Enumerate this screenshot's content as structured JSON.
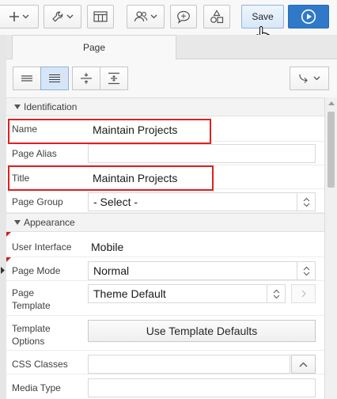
{
  "toolbar": {
    "items": [
      {
        "name": "add-menu-button",
        "icon": "plus-icon"
      },
      {
        "name": "utilities-menu-button",
        "icon": "wrench-icon"
      },
      {
        "name": "shared-components-button",
        "icon": "grid-icon"
      },
      {
        "name": "team-development-button",
        "icon": "people-icon"
      },
      {
        "name": "comments-button",
        "icon": "comment-icon"
      },
      {
        "name": "shapes-button",
        "icon": "shapes-icon"
      }
    ],
    "save_label": "Save",
    "run_icon": "play-icon"
  },
  "tabs": {
    "page_label": "Page"
  },
  "view_toolbar": {
    "buttons": [
      "show-common-icon",
      "show-all-icon",
      "collapse-all-icon",
      "expand-all-icon"
    ],
    "goto_icon": "goto-group-icon"
  },
  "sections": {
    "identification": "Identification",
    "appearance": "Appearance"
  },
  "properties": {
    "name": {
      "label": "Name",
      "value": "Maintain Projects"
    },
    "page_alias": {
      "label": "Page Alias",
      "value": ""
    },
    "title": {
      "label": "Title",
      "value": "Maintain Projects"
    },
    "page_group": {
      "label": "Page Group",
      "value": "- Select -"
    },
    "user_interface": {
      "label": "User Interface",
      "value": "Mobile"
    },
    "page_mode": {
      "label": "Page Mode",
      "value": "Normal"
    },
    "page_template": {
      "label_line1": "Page",
      "label_line2": "Template",
      "value": "Theme Default"
    },
    "template_options": {
      "label_line1": "Template",
      "label_line2": "Options",
      "button": "Use Template Defaults"
    },
    "css_classes": {
      "label": "CSS Classes",
      "value": ""
    },
    "media_type": {
      "label": "Media Type",
      "value": ""
    }
  },
  "colors": {
    "accent": "#2f79c8",
    "highlight": "#e02020"
  }
}
